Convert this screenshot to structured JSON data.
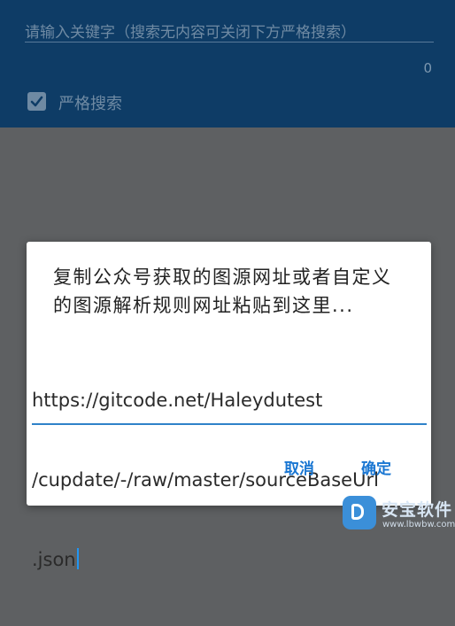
{
  "search": {
    "placeholder": "请输入关键字（搜索无内容可关闭下方严格搜索）",
    "result_count": "0",
    "strict_label": "严格搜索",
    "strict_checked": true
  },
  "dialog": {
    "title": "复制公众号获取的图源网址或者自定义的图源解析规则网址粘贴到这里...",
    "input_lines": [
      "https://gitcode.net/Haleydutest",
      "/cupdate/-/raw/master/sourceBaseUrl",
      ".json"
    ],
    "cancel_label": "取消",
    "ok_label": "确定"
  },
  "watermark": {
    "text": "安宝软件",
    "url": "www.lbwbw.com"
  },
  "colors": {
    "accent": "#1976d2",
    "header_dimmed": "#0e3c66",
    "overlay": "#5e6062"
  }
}
